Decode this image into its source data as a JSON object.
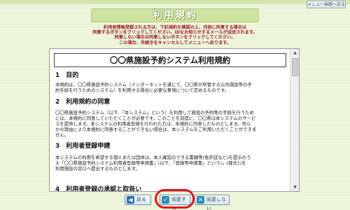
{
  "header": {
    "menu_button": "メニュー画面へ戻る",
    "title": "利用規約"
  },
  "notice": {
    "lines": [
      "利用者情報登録される方は、下記規約を確認の上、内容に同意する場合は",
      "同意するボタンをクリックしてください。IDをお知らせするメールが送信されます。",
      "同意しない場合は同意しないボタンをクリックしてください。",
      "この場合、手続きをキャンセルしてメニューへ戻ります。"
    ]
  },
  "document": {
    "heading": "〇〇県施設予約システム利用規約",
    "sections": [
      {
        "title": "1　目的",
        "lines": [
          "本規約は、〇〇県施設予約システム（インターネットを通じて、〇〇県が所管する公共施設等の予",
          "約手続を行うためのシステム）を利用する場合に必要な事項について定めるものです。"
        ]
      },
      {
        "title": "2　利用規約の同意",
        "lines": [
          "〇〇県施設予約システム（以下、「本システム」という）を利用して施設の予約等の手続を行うため",
          "には、本規約に同意していただくことが必要です。このことを前提に、〇〇県は本システムのサービ",
          "スを提供します。本システムの利用者登録を行われた方は、本規約に同意したものとします。何ら",
          "かの理由により本規約に同意することができない場合は、本システムをご利用いただくことができま",
          "せん。"
        ]
      },
      {
        "title": "3　利用者登録申請",
        "lines": [
          "本システムの利用を希望する個人または団体は、本人確認のできる書類等(免許証など)を提示のう",
          "え「〇〇県施設予約システム利用者登録等申請書」(以下、「登録等申請書」という)」(様式1)を",
          "利用施設の窓口へ提出するものとします。"
        ]
      },
      {
        "title": "4　利用者登録の承認と取扱い",
        "lines": []
      }
    ]
  },
  "buttons": {
    "back": "戻る",
    "agree": "同意する",
    "disagree": "同意しない"
  }
}
